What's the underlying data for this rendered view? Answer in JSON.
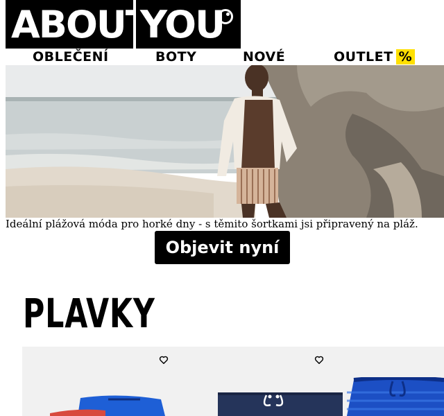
{
  "header": {
    "logo": {
      "part1": "ABOUT",
      "part2": "YOU"
    }
  },
  "nav": {
    "items": [
      {
        "label": "OBLEČENÍ"
      },
      {
        "label": "BOTY"
      },
      {
        "label": "NOVÉ"
      },
      {
        "label": "OUTLET",
        "badge": "%"
      }
    ],
    "badge_color": "#ffe000"
  },
  "hero": {
    "caption": "Ideální plážová móda pro horké dny - s těmito šortkami jsi připravený na pláž.",
    "cta_label": "Objevit nyní"
  },
  "section": {
    "title": "PLAVKY"
  },
  "products": [
    {
      "wishlist_icon": "heart-icon",
      "color": "#1e5fd6"
    },
    {
      "wishlist_icon": "heart-icon",
      "color": "#25345a"
    },
    {
      "wishlist_icon": "heart-icon",
      "color": "#1c4fc4"
    }
  ]
}
